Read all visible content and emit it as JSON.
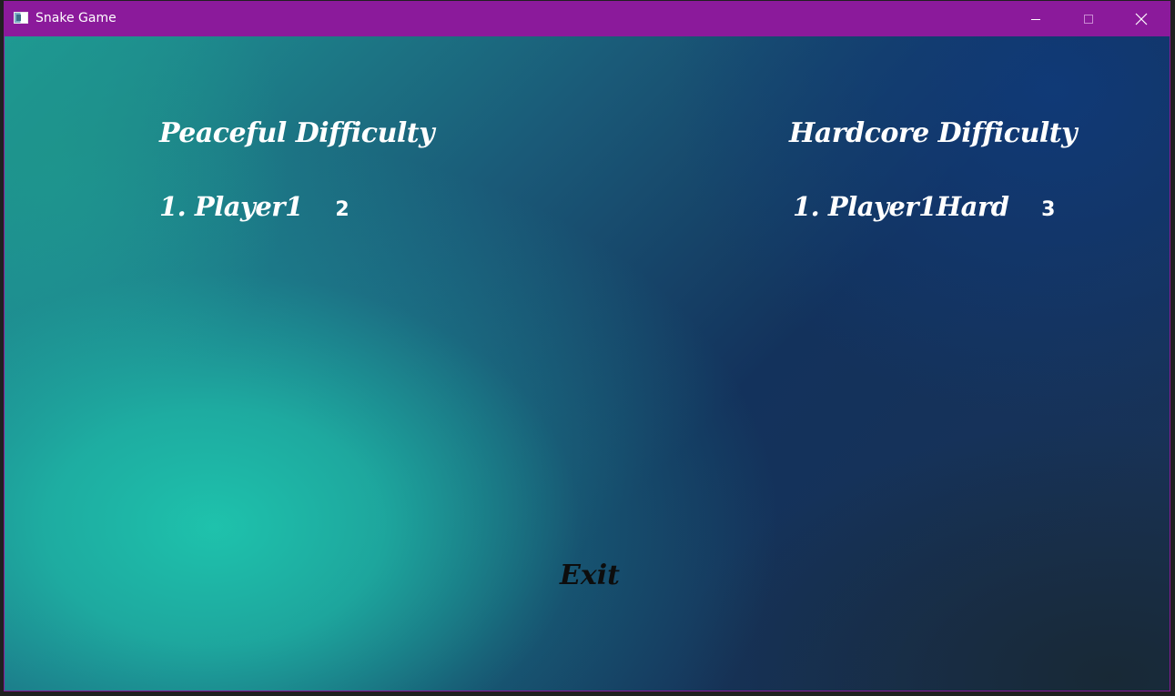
{
  "window": {
    "title": "Snake Game",
    "accent_color": "#8b1a9b",
    "icon": "app-window-icon",
    "controls": [
      "minimize-icon",
      "maximize-icon",
      "close-icon"
    ]
  },
  "peaceful": {
    "title": "Peaceful Difficulty",
    "entries": [
      {
        "rank": "1.",
        "name": "Player1",
        "score": "2"
      }
    ]
  },
  "hardcore": {
    "title": "Hardcore Difficulty",
    "entries": [
      {
        "rank": "1.",
        "name": "Player1Hard",
        "score": "3"
      }
    ]
  },
  "exit_label": "Exit"
}
